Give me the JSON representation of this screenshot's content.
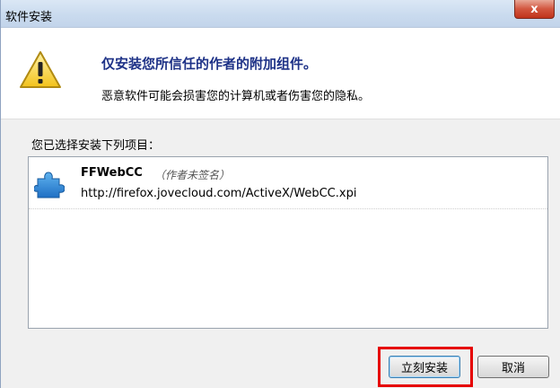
{
  "window": {
    "title": "软件安装",
    "close_label": "x"
  },
  "header": {
    "headline": "仅安装您所信任的作者的附加组件。",
    "subline": "恶意软件可能会损害您的计算机或者伤害您的隐私。",
    "icon": "warning-icon"
  },
  "list": {
    "label": "您已选择安装下列项目：",
    "items": [
      {
        "name": "FFWebCC",
        "note": "（作者未签名）",
        "url": "http://firefox.jovecloud.com/ActiveX/WebCC.xpi",
        "icon": "puzzle-piece-icon"
      }
    ]
  },
  "buttons": {
    "install_label": "立刻安装",
    "cancel_label": "取消"
  },
  "colors": {
    "headline": "#1e3287",
    "highlight": "#e60000",
    "titlebar": "#c9daee"
  }
}
